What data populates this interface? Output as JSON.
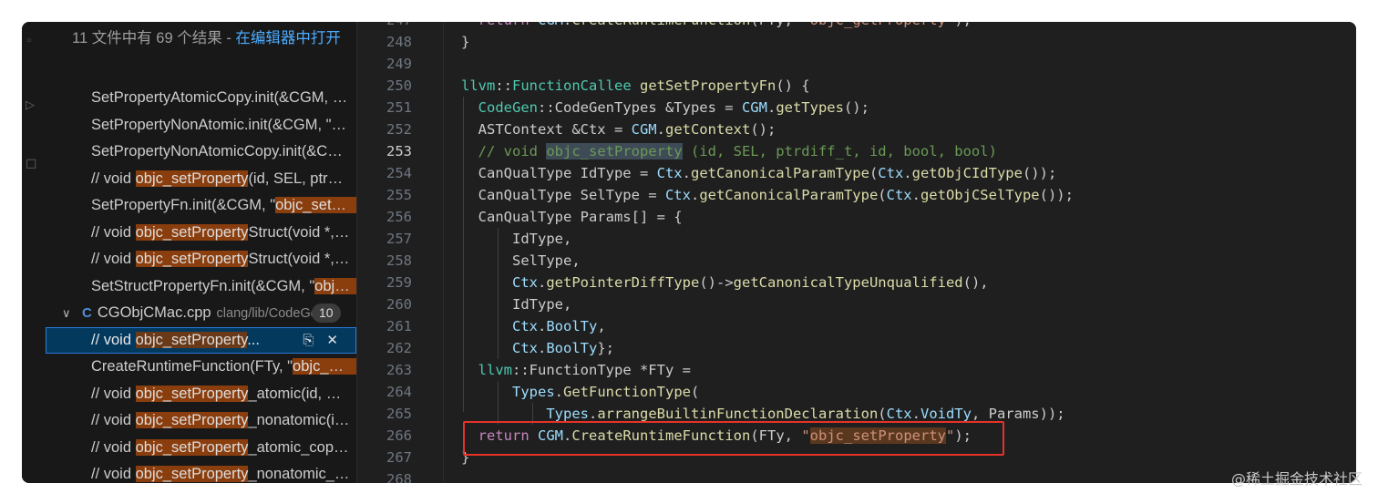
{
  "sidebar": {
    "summary_prefix": "11 文件中有 69 个结果 - ",
    "summary_link": "在编辑器中打开",
    "results_before": [
      {
        "pre": "SetPropertyAtomicCopy.init(&CGM, \"objc_setPropertyAtomicCopy\")",
        "hl": "",
        "post": ""
      },
      {
        "pre": "SetPropertyNonAtomic.init(&CGM, \"objc_setPropertyNonAtomic\")",
        "hl": "",
        "post": ""
      },
      {
        "pre": "SetPropertyNonAtomicCopy.init(&CGM, \"objc_setPropertyNonAtomicCopy\")",
        "hl": "",
        "post": ""
      },
      {
        "pre": "// void ",
        "hl": "objc_setProperty",
        "post": "(id, SEL, ptrdiff_t, id, bool, bool)"
      },
      {
        "pre": "SetPropertyFn.init(&CGM, \"",
        "hl": "objc_setProperty",
        "post": "\")"
      },
      {
        "pre": "// void ",
        "hl": "objc_setProperty",
        "post": "Struct(void *, void *, size_t, bool, bool)"
      },
      {
        "pre": "// void ",
        "hl": "objc_setProperty",
        "post": "Struct(void *, void *, size_t, bool, bool)"
      },
      {
        "pre": "SetStructPropertyFn.init(&CGM, \"",
        "hl": "objc_setPropertyStruct",
        "post": "\")"
      }
    ],
    "file": {
      "name": "CGObjCMac.cpp",
      "path": "clang/lib/CodeGen",
      "count": "10"
    },
    "selected": {
      "pre": "// void ",
      "hl": "objc_setProperty",
      "post": "..."
    },
    "results_after": [
      {
        "pre": "CreateRuntimeFunction(FTy, \"",
        "hl": "objc_setProperty",
        "post": "\")"
      },
      {
        "pre": "// void ",
        "hl": "objc_setProperty",
        "post": "_atomic(id, SEL, id, ptrdiff_t)"
      },
      {
        "pre": "// void ",
        "hl": "objc_setProperty",
        "post": "_nonatomic(id, SEL, id, ptrdiff_t)"
      },
      {
        "pre": "// void ",
        "hl": "objc_setProperty",
        "post": "_atomic_copy(id, SEL, id, ptrdiff_t)"
      },
      {
        "pre": "// void ",
        "hl": "objc_setProperty",
        "post": "_nonatomic_copy(id, SEL, id, ptrdiff_t)"
      }
    ]
  },
  "editor": {
    "current_line": "253",
    "lines": [
      {
        "n": "247",
        "t": [
          [
            "  ",
            ""
          ],
          [
            "return",
            "t-kw2"
          ],
          [
            " ",
            ""
          ],
          [
            "CGM",
            "t-var"
          ],
          [
            ".",
            ""
          ],
          [
            "CreateRuntimeFunction",
            "t-fn"
          ],
          [
            "(FTy, ",
            ""
          ],
          [
            "\"objc_getProperty\"",
            "t-str"
          ],
          [
            ");",
            ""
          ]
        ]
      },
      {
        "n": "248",
        "t": [
          [
            "}",
            ""
          ]
        ]
      },
      {
        "n": "249",
        "t": [
          [
            "",
            ""
          ]
        ]
      },
      {
        "n": "250",
        "t": [
          [
            "llvm",
            "t-ty"
          ],
          [
            "::",
            ""
          ],
          [
            "FunctionCallee",
            "t-ty"
          ],
          [
            " ",
            ""
          ],
          [
            "getSetPropertyFn",
            "t-fn"
          ],
          [
            "() {",
            ""
          ]
        ]
      },
      {
        "n": "251",
        "t": [
          [
            "  ",
            ""
          ],
          [
            "CodeGen",
            "t-ty"
          ],
          [
            "::CodeGenTypes &Types = ",
            ""
          ],
          [
            "CGM",
            "t-var"
          ],
          [
            ".",
            ""
          ],
          [
            "getTypes",
            "t-fn"
          ],
          [
            "();",
            ""
          ]
        ]
      },
      {
        "n": "252",
        "t": [
          [
            "  ASTContext &Ctx = ",
            ""
          ],
          [
            "CGM",
            "t-var"
          ],
          [
            ".",
            ""
          ],
          [
            "getContext",
            "t-fn"
          ],
          [
            "();",
            ""
          ]
        ]
      },
      {
        "n": "253",
        "t": [
          [
            "  ",
            ""
          ],
          [
            "// void ",
            "t-cm"
          ],
          [
            "objc_setProperty",
            "t-cmhl"
          ],
          [
            " (id, SEL, ptrdiff_t, id, bool, bool)",
            "t-cm"
          ]
        ]
      },
      {
        "n": "254",
        "t": [
          [
            "  CanQualType IdType = ",
            ""
          ],
          [
            "Ctx",
            "t-var"
          ],
          [
            ".",
            ""
          ],
          [
            "getCanonicalParamType",
            "t-fn"
          ],
          [
            "(",
            ""
          ],
          [
            "Ctx",
            "t-var"
          ],
          [
            ".",
            ""
          ],
          [
            "getObjCIdType",
            "t-fn"
          ],
          [
            "());",
            ""
          ]
        ]
      },
      {
        "n": "255",
        "t": [
          [
            "  CanQualType SelType = ",
            ""
          ],
          [
            "Ctx",
            "t-var"
          ],
          [
            ".",
            ""
          ],
          [
            "getCanonicalParamType",
            "t-fn"
          ],
          [
            "(",
            ""
          ],
          [
            "Ctx",
            "t-var"
          ],
          [
            ".",
            ""
          ],
          [
            "getObjCSelType",
            "t-fn"
          ],
          [
            "());",
            ""
          ]
        ]
      },
      {
        "n": "256",
        "t": [
          [
            "  CanQualType Params[] = {",
            ""
          ]
        ]
      },
      {
        "n": "257",
        "t": [
          [
            "      IdType,",
            ""
          ]
        ]
      },
      {
        "n": "258",
        "t": [
          [
            "      SelType,",
            ""
          ]
        ]
      },
      {
        "n": "259",
        "t": [
          [
            "      ",
            ""
          ],
          [
            "Ctx",
            "t-var"
          ],
          [
            ".",
            ""
          ],
          [
            "getPointerDiffType",
            "t-fn"
          ],
          [
            "()->",
            ""
          ],
          [
            "getCanonicalTypeUnqualified",
            "t-fn"
          ],
          [
            "(),",
            ""
          ]
        ]
      },
      {
        "n": "260",
        "t": [
          [
            "      IdType,",
            ""
          ]
        ]
      },
      {
        "n": "261",
        "t": [
          [
            "      ",
            ""
          ],
          [
            "Ctx",
            "t-var"
          ],
          [
            ".",
            ""
          ],
          [
            "BoolTy",
            "t-var"
          ],
          [
            ",",
            ""
          ]
        ]
      },
      {
        "n": "262",
        "t": [
          [
            "      ",
            ""
          ],
          [
            "Ctx",
            "t-var"
          ],
          [
            ".",
            ""
          ],
          [
            "BoolTy",
            "t-var"
          ],
          [
            "};",
            ""
          ]
        ]
      },
      {
        "n": "263",
        "t": [
          [
            "  ",
            ""
          ],
          [
            "llvm",
            "t-ty"
          ],
          [
            "::FunctionType *FTy =",
            ""
          ]
        ]
      },
      {
        "n": "264",
        "t": [
          [
            "      ",
            ""
          ],
          [
            "Types",
            "t-var"
          ],
          [
            ".",
            ""
          ],
          [
            "GetFunctionType",
            "t-fn"
          ],
          [
            "(",
            ""
          ]
        ]
      },
      {
        "n": "265",
        "t": [
          [
            "          ",
            ""
          ],
          [
            "Types",
            "t-var"
          ],
          [
            ".",
            ""
          ],
          [
            "arrangeBuiltinFunctionDeclaration",
            "t-fn"
          ],
          [
            "(",
            ""
          ],
          [
            "Ctx",
            "t-var"
          ],
          [
            ".",
            ""
          ],
          [
            "VoidTy",
            "t-var"
          ],
          [
            ", Params));",
            ""
          ]
        ]
      },
      {
        "n": "266",
        "t": [
          [
            "  ",
            ""
          ],
          [
            "return",
            "t-kw2"
          ],
          [
            " ",
            ""
          ],
          [
            "CGM",
            "t-var"
          ],
          [
            ".",
            ""
          ],
          [
            "CreateRuntimeFunction",
            "t-fn"
          ],
          [
            "(FTy, ",
            ""
          ],
          [
            "\"",
            "t-str"
          ],
          [
            "objc_setProperty",
            "t-strhl"
          ],
          [
            "\"",
            "t-str"
          ],
          [
            ");",
            ""
          ]
        ]
      },
      {
        "n": "267",
        "t": [
          [
            "}",
            ""
          ]
        ]
      },
      {
        "n": "268",
        "t": [
          [
            "",
            ""
          ]
        ]
      }
    ]
  },
  "icons": {
    "chevron": "chevron-down-icon",
    "cpp": "cpp-file-icon",
    "replace": "replace-icon",
    "dismiss": "close-icon"
  },
  "watermark": "@稀土掘金技术社区"
}
